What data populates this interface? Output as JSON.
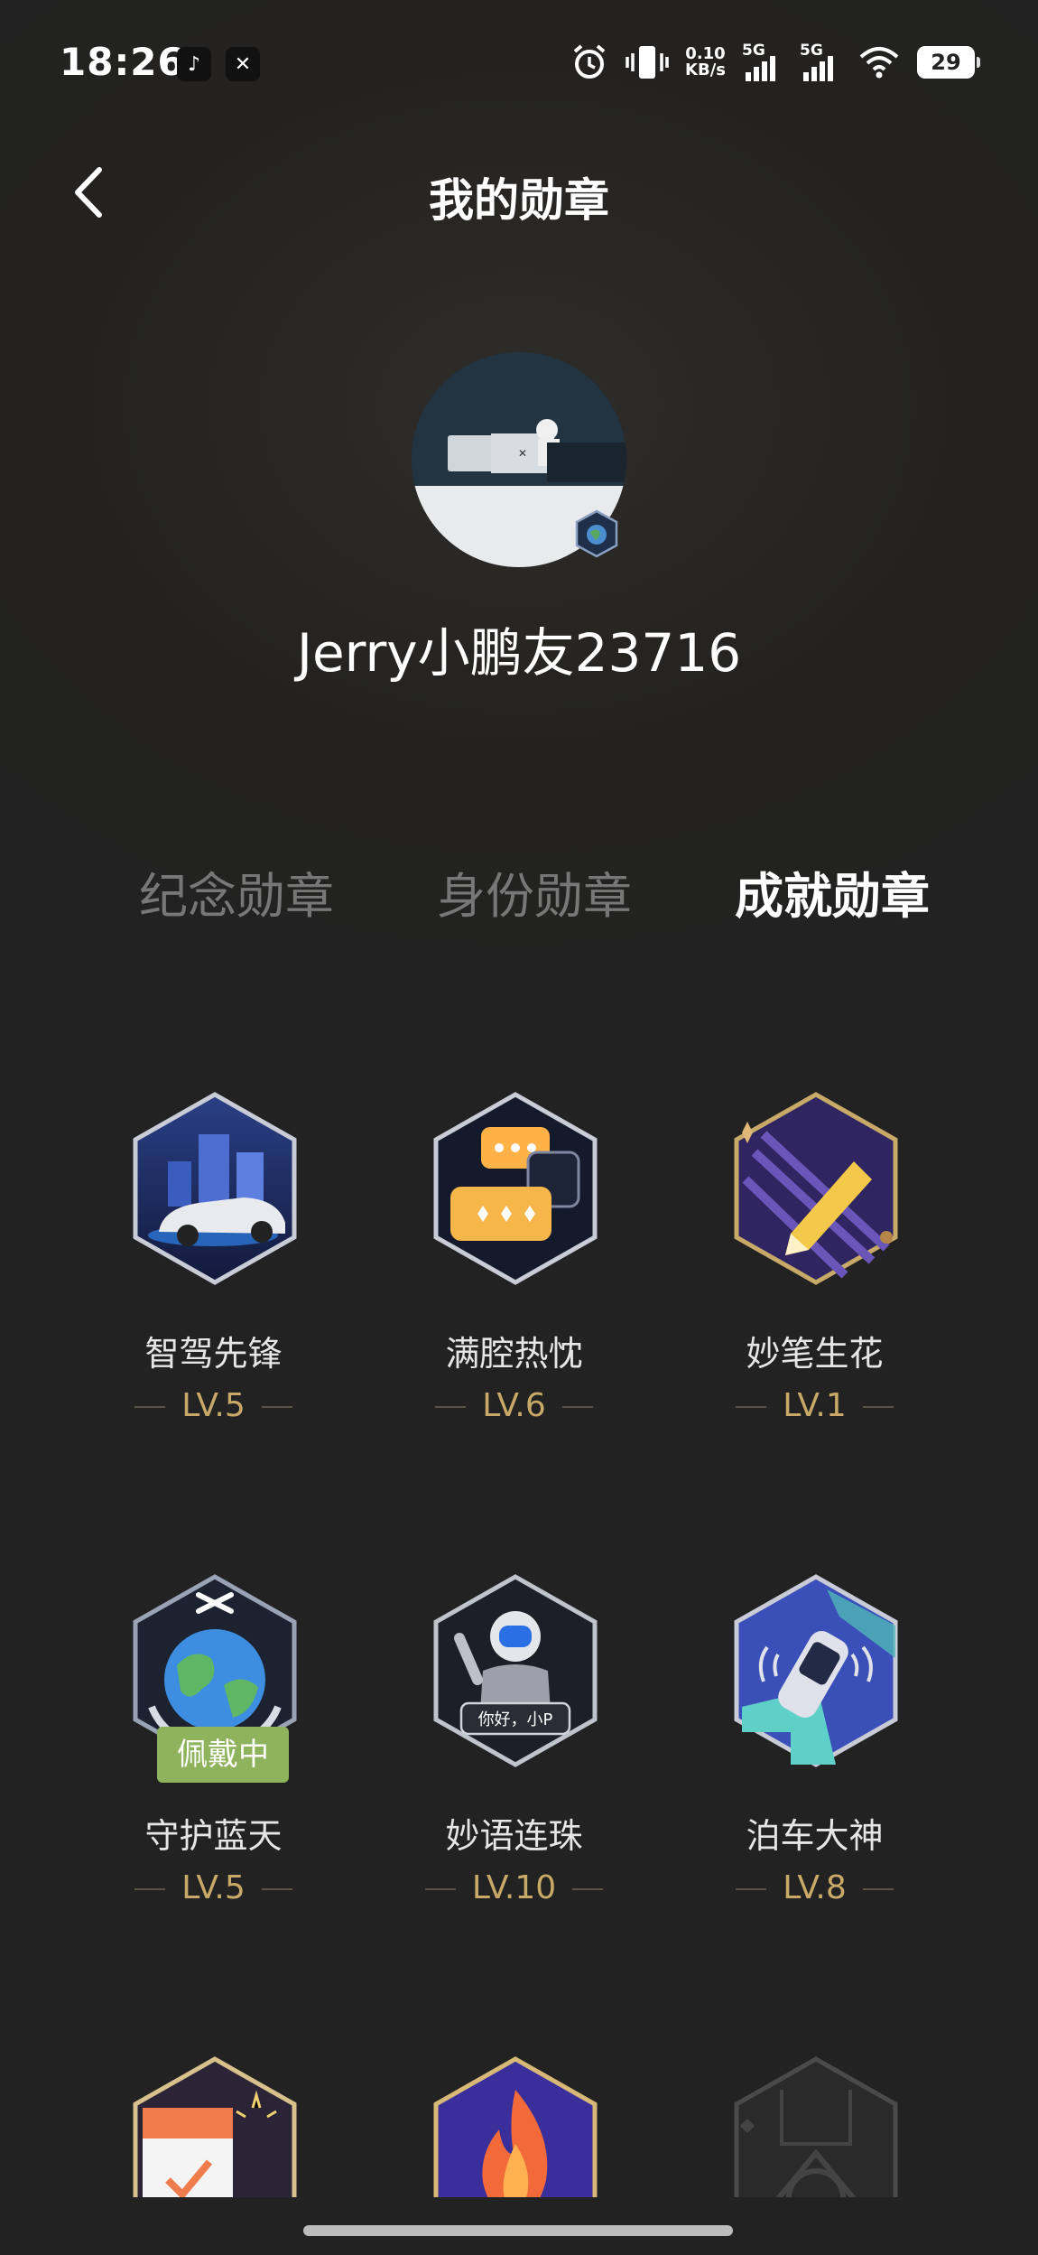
{
  "status_bar": {
    "time": "18:26",
    "apps": [
      "tiktok-icon",
      "xpeng-icon"
    ],
    "net_speed_value": "0.10",
    "net_speed_unit": "KB/s",
    "signal1_label": "5G",
    "signal2_label": "5G",
    "battery": "29"
  },
  "header": {
    "title": "我的勋章"
  },
  "profile": {
    "username": "Jerry小鹏友23716"
  },
  "tabs": [
    {
      "label": "纪念勋章",
      "active": false
    },
    {
      "label": "身份勋章",
      "active": false
    },
    {
      "label": "成就勋章",
      "active": true
    }
  ],
  "badges": [
    {
      "name": "智驾先锋",
      "level": "LV.5",
      "icon": "autopilot-car-badge-icon"
    },
    {
      "name": "满腔热忱",
      "level": "LV.6",
      "icon": "chat-bubbles-badge-icon"
    },
    {
      "name": "妙笔生花",
      "level": "LV.1",
      "icon": "pencil-badge-icon"
    },
    {
      "name": "守护蓝天",
      "level": "LV.5",
      "icon": "earth-badge-icon",
      "tag": "佩戴中"
    },
    {
      "name": "妙语连珠",
      "level": "LV.10",
      "icon": "voice-assistant-badge-icon",
      "screen_text": "你好，小P"
    },
    {
      "name": "泊车大神",
      "level": "LV.8",
      "icon": "parking-badge-icon"
    },
    {
      "icon": "calendar-badge-icon"
    },
    {
      "icon": "flame-badge-icon"
    },
    {
      "icon": "locked-road-badge-icon"
    }
  ],
  "colors": {
    "level_gold": "#c9a968",
    "wearing_green": "#8fb35c",
    "inactive_tab": "#777777"
  }
}
